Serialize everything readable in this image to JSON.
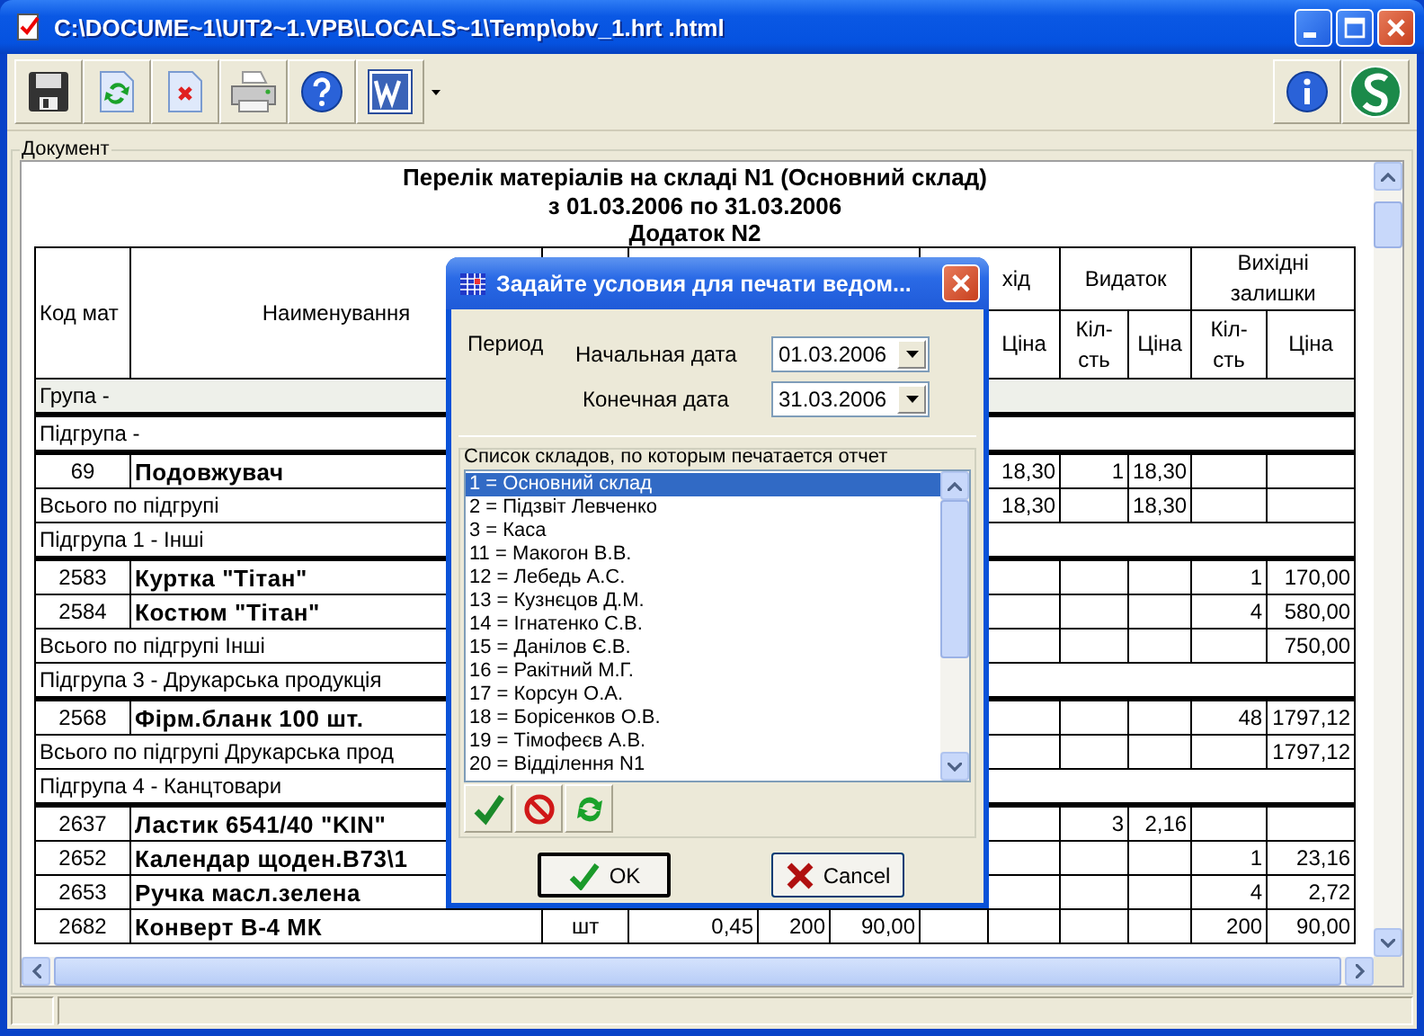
{
  "window": {
    "title": "C:\\DOCUME~1\\UIT2~1.VPB\\LOCALS~1\\Temp\\obv_1.hrt .html"
  },
  "document": {
    "group_label": "Документ",
    "title": "Перелік матеріалів на складі N1 (Основний склад)",
    "period": "з 01.03.2006 по 31.03.2006",
    "subtitle": "Додаток N2",
    "header": {
      "code": "Код мат",
      "name": "Наименування",
      "group_5": "хід",
      "group_6": "Видаток",
      "group_7": "Вихідні залишки",
      "sub": [
        "Ціна",
        "Кіл-сть",
        "Ціна",
        "Кіл-сть",
        "Ціна"
      ]
    },
    "rows": [
      {
        "kind": "group",
        "label": "Група -"
      },
      {
        "kind": "subgroup",
        "label": "Підгрупа -"
      },
      {
        "kind": "item",
        "code": "69",
        "name": "Подовжувач",
        "cells": [
          null,
          null,
          null,
          null,
          null,
          "18,30",
          "1",
          "18,30",
          null,
          null
        ]
      },
      {
        "kind": "subtotal",
        "label": "Всього по підгрупі",
        "cells": [
          null,
          null,
          null,
          null,
          null,
          "18,30",
          null,
          "18,30",
          null,
          null
        ]
      },
      {
        "kind": "subgroup",
        "label": "Підгрупа 1 - Інші"
      },
      {
        "kind": "item",
        "code": "2583",
        "name": "Куртка \"Тітан\"",
        "cells": [
          null,
          null,
          null,
          null,
          null,
          null,
          null,
          null,
          "1",
          "170,00"
        ]
      },
      {
        "kind": "item",
        "code": "2584",
        "name": "Костюм \"Тітан\"",
        "cells": [
          null,
          null,
          null,
          null,
          null,
          null,
          null,
          null,
          "4",
          "580,00"
        ]
      },
      {
        "kind": "subtotal",
        "label": "Всього по підгрупі Інші",
        "cells": [
          null,
          null,
          null,
          null,
          null,
          null,
          null,
          null,
          null,
          "750,00"
        ]
      },
      {
        "kind": "subgroup",
        "label": "Підгрупа 3 - Друкарська продукція"
      },
      {
        "kind": "item",
        "code": "2568",
        "name": "Фірм.бланк 100 шт.",
        "cells": [
          null,
          null,
          null,
          null,
          null,
          null,
          null,
          null,
          "48",
          "1797,12"
        ]
      },
      {
        "kind": "subtotal",
        "label": "Всього по підгрупі Друкарська прод",
        "cells": [
          null,
          null,
          null,
          null,
          null,
          null,
          null,
          null,
          null,
          "1797,12"
        ]
      },
      {
        "kind": "subgroup",
        "label": "Підгрупа 4 - Канцтовари"
      },
      {
        "kind": "item",
        "code": "2637",
        "name": "Ластик 6541/40 \"KIN\"",
        "cells": [
          null,
          null,
          null,
          null,
          null,
          null,
          "3",
          "2,16",
          null,
          null
        ]
      },
      {
        "kind": "item",
        "code": "2652",
        "name": "Календар щоден.B73\\1",
        "cells": [
          null,
          null,
          null,
          null,
          null,
          null,
          null,
          null,
          "1",
          "23,16"
        ]
      },
      {
        "kind": "item",
        "code": "2653",
        "name": "Ручка масл.зелена",
        "cells": [
          null,
          null,
          null,
          null,
          null,
          null,
          null,
          null,
          "4",
          "2,72"
        ]
      },
      {
        "kind": "item",
        "code": "2682",
        "name": "Конверт В-4 МК",
        "cells": [
          "шт",
          "0,45",
          "200",
          "90,00",
          null,
          null,
          null,
          null,
          "200",
          "90,00"
        ]
      }
    ]
  },
  "dialog": {
    "title": "Задайте условия для печати ведом...",
    "period_label": "Период",
    "start_date": {
      "label": "Начальная дата",
      "value": "01.03.2006"
    },
    "end_date": {
      "label": "Конечная дата",
      "value": "31.03.2006"
    },
    "list_label": "Список складов, по которым печатается отчет",
    "warehouses": [
      {
        "label": "1 = Основний склад",
        "selected": true
      },
      {
        "label": "2 = Підзвіт Левченко",
        "selected": false
      },
      {
        "label": "3 = Каса",
        "selected": false
      },
      {
        "label": "11 = Макогон В.В.",
        "selected": false
      },
      {
        "label": "12 = Лебедь А.С.",
        "selected": false
      },
      {
        "label": "13 = Кузнєцов Д.М.",
        "selected": false
      },
      {
        "label": "14 = Ігнатенко С.В.",
        "selected": false
      },
      {
        "label": "15 = Данілов Є.В.",
        "selected": false
      },
      {
        "label": "16 = Ракітний М.Г.",
        "selected": false
      },
      {
        "label": "17 = Корсун О.А.",
        "selected": false
      },
      {
        "label": "18 = Борісенков О.В.",
        "selected": false
      },
      {
        "label": "19 = Тімофеєв А.В.",
        "selected": false
      },
      {
        "label": "20 = Відділення N1",
        "selected": false
      }
    ],
    "ok": "OK",
    "cancel": "Cancel"
  }
}
